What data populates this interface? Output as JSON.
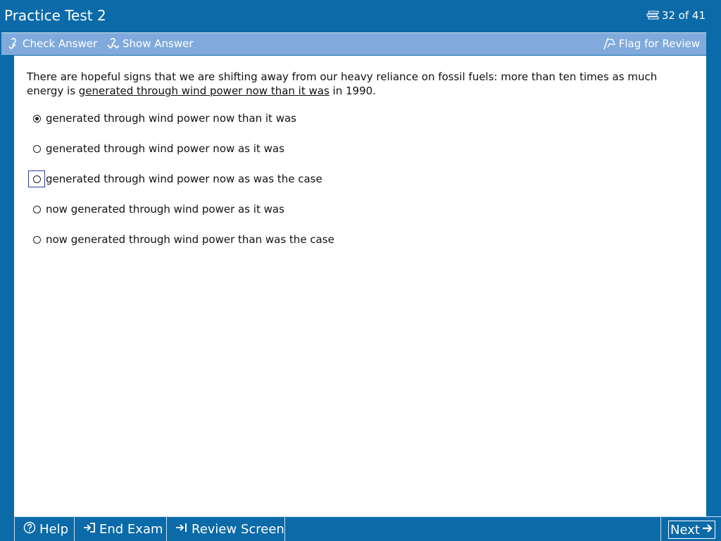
{
  "window": {
    "title": "Practice Test 2",
    "question_counter": "32 of 41"
  },
  "toolbar": {
    "check_answer": "Check Answer",
    "show_answer": "Show Answer",
    "flag_for_review": "Flag for Review"
  },
  "question": {
    "stem_before": "There are hopeful signs that we are shifting away from our heavy reliance on fossil fuels:  more than ten times as much energy is ",
    "stem_underlined": "generated through wind power now than it was",
    "stem_after": " in 1990.",
    "choices": [
      {
        "label": "generated through wind power now than it was",
        "selected": true,
        "focused": false
      },
      {
        "label": "generated through wind power now as it was",
        "selected": false,
        "focused": false
      },
      {
        "label": "generated through wind power now as was the case",
        "selected": false,
        "focused": true
      },
      {
        "label": "now generated through wind power as it was",
        "selected": false,
        "focused": false
      },
      {
        "label": "now generated through wind power than was the case",
        "selected": false,
        "focused": false
      }
    ]
  },
  "footer": {
    "help": "Help",
    "end_exam": "End Exam",
    "review_screen": "Review Screen",
    "next": "Next"
  },
  "colors": {
    "background": "#0b6aa8",
    "toolbar": "#80aadb",
    "content": "#ffffff"
  },
  "icons": [
    "list-icon",
    "check-answer-icon",
    "show-answer-icon",
    "flag-icon",
    "help-icon",
    "end-exam-icon",
    "review-screen-icon",
    "next-arrow-icon"
  ]
}
